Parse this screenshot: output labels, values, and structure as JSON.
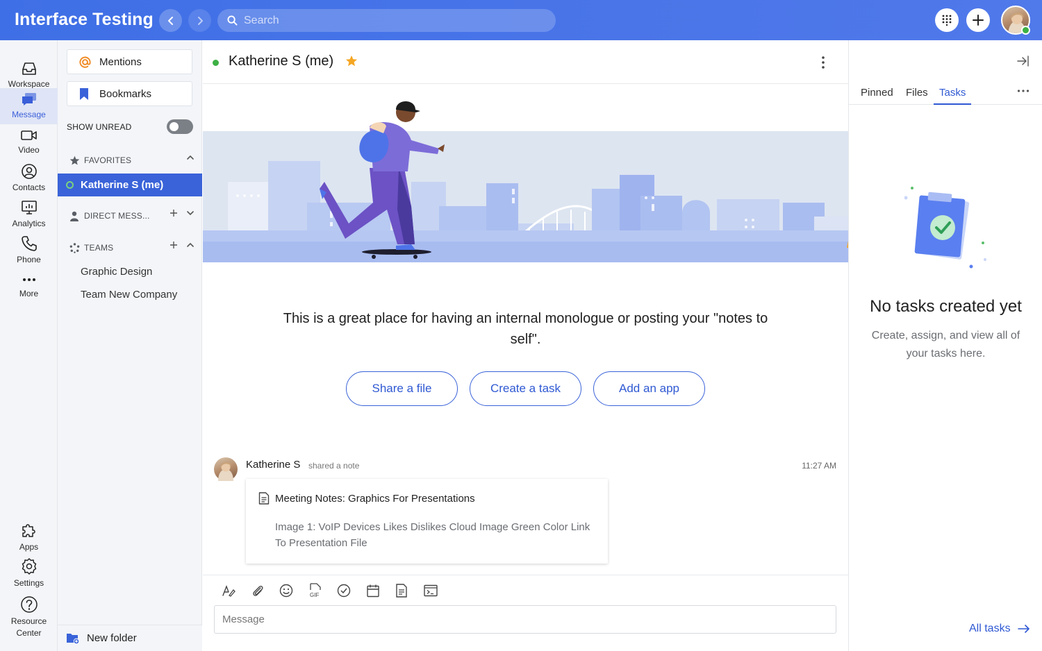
{
  "app": {
    "title": "Interface Testing"
  },
  "search": {
    "placeholder": "Search"
  },
  "rail": {
    "items": [
      {
        "label": "Workspace",
        "icon": "inbox-icon"
      },
      {
        "label": "Message",
        "icon": "message-icon"
      },
      {
        "label": "Video",
        "icon": "video-icon"
      },
      {
        "label": "Contacts",
        "icon": "contacts-icon"
      },
      {
        "label": "Analytics",
        "icon": "analytics-icon"
      },
      {
        "label": "Phone",
        "icon": "phone-icon"
      },
      {
        "label": "More",
        "icon": "more-icon"
      }
    ],
    "bottom": [
      {
        "label": "Apps",
        "icon": "puzzle-icon"
      },
      {
        "label": "Settings",
        "icon": "gear-icon"
      },
      {
        "label": "Resource Center",
        "icon": "help-icon"
      }
    ]
  },
  "sidebar": {
    "mentions": "Mentions",
    "bookmarks": "Bookmarks",
    "show_unread": "SHOW UNREAD",
    "favorites": {
      "title": "FAVORITES",
      "items": [
        "Katherine S (me)"
      ]
    },
    "direct": {
      "title": "DIRECT MESS..."
    },
    "teams": {
      "title": "TEAMS",
      "items": [
        "Graphic Design",
        "Team New Company"
      ]
    },
    "new_folder": "New folder"
  },
  "conversation": {
    "title": "Katherine S (me)",
    "intro": "This is a great place for having an internal monologue or posting your \"notes to self\".",
    "actions": [
      "Share a file",
      "Create a task",
      "Add an app"
    ],
    "message": {
      "author": "Katherine S",
      "action": "shared a note",
      "time": "11:27 AM",
      "note_title": "Meeting Notes: Graphics For Presentations",
      "note_body": "Image 1: VoIP Devices Likes Dislikes Cloud Image Green Color Link To Presentation File"
    },
    "composer": {
      "placeholder": "Message"
    }
  },
  "right_panel": {
    "tabs": [
      "Pinned",
      "Files",
      "Tasks"
    ],
    "active_tab": "Tasks",
    "empty_title": "No tasks created yet",
    "empty_sub": "Create, assign, and view all of your tasks here.",
    "all_tasks": "All tasks"
  },
  "colors": {
    "accent": "#3a63d9",
    "topbar": "#4a75e8",
    "online": "#3cb043",
    "star": "#f5a623"
  }
}
